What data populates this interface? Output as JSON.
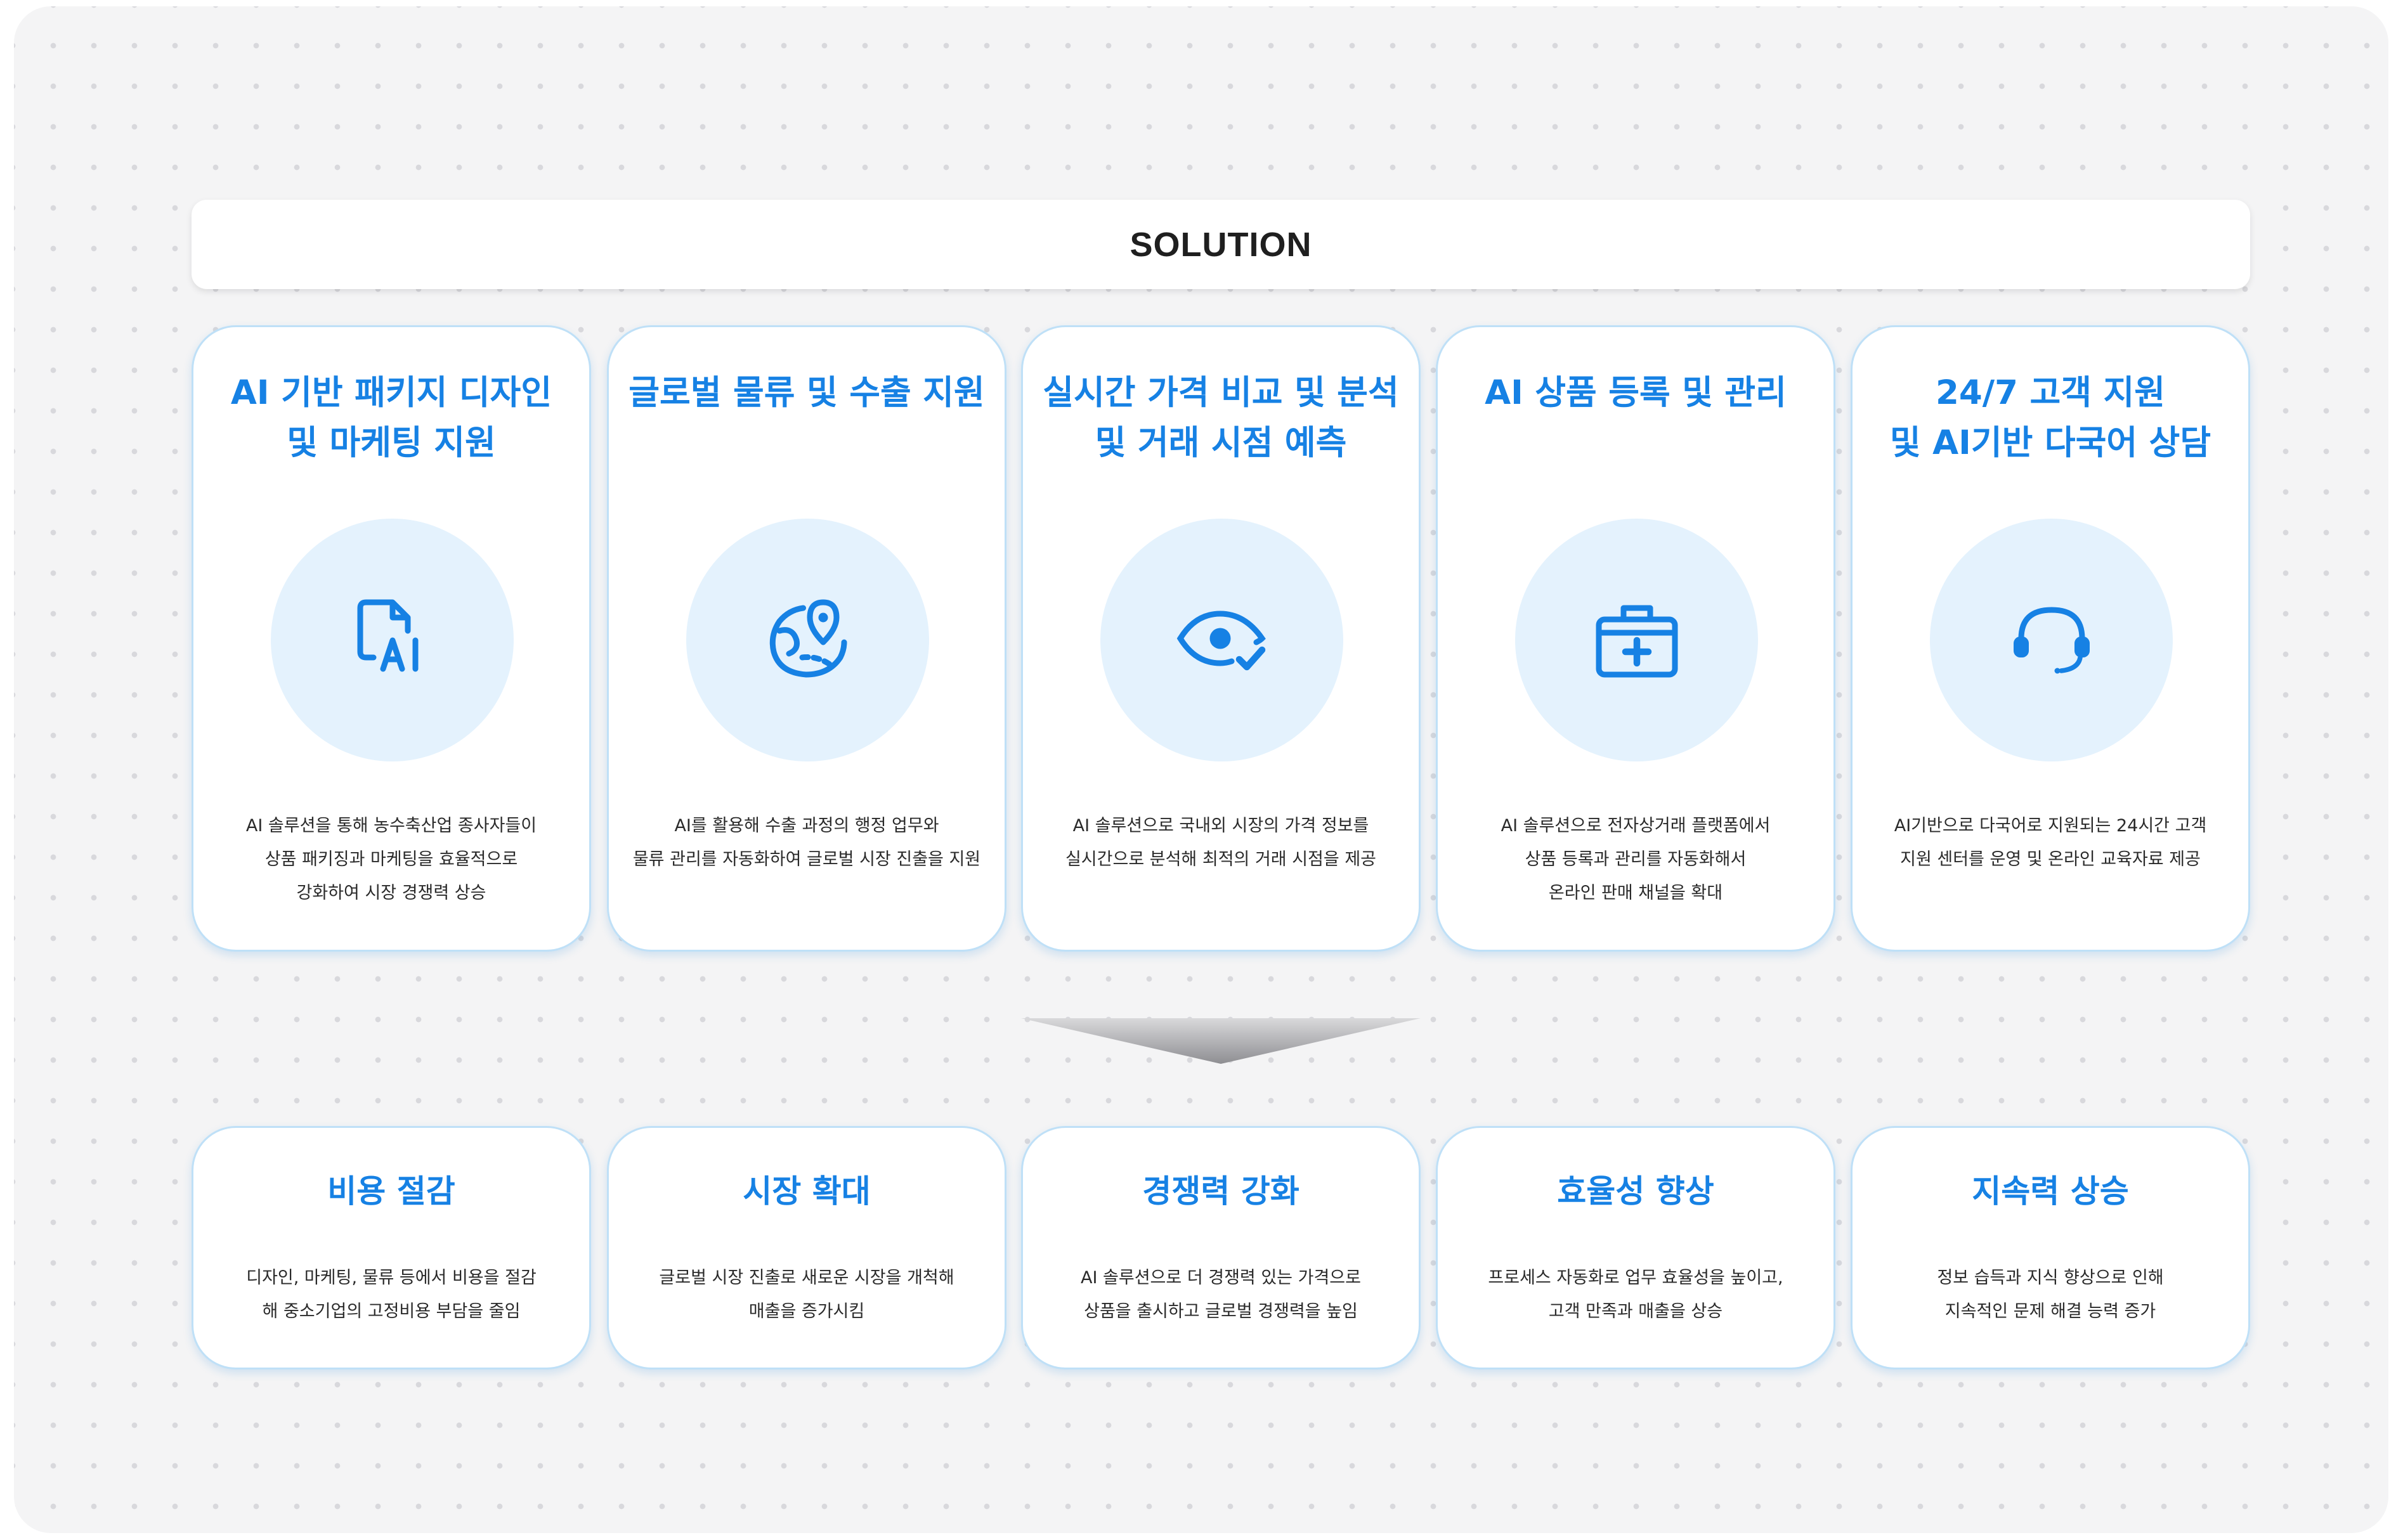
{
  "header": {
    "title": "SOLUTION"
  },
  "solutions": [
    {
      "title": "AI 기반 패키지 디자인\n및 마케팅 지원",
      "icon": "ai-document-icon",
      "description": "AI 솔루션을 통해 농수축산업 종사자들이\n상품 패키징과 마케팅을 효율적으로\n강화하여 시장 경쟁력 상승"
    },
    {
      "title": "글로벌 물류 및 수출 지원",
      "icon": "globe-location-icon",
      "description": "AI를 활용해 수출 과정의 행정 업무와\n물류 관리를 자동화하여 글로벌 시장 진출을 지원"
    },
    {
      "title": "실시간 가격 비교 및 분석\n및 거래 시점 예측",
      "icon": "eye-check-icon",
      "description": "AI 솔루션으로 국내외 시장의 가격 정보를\n실시간으로 분석해 최적의 거래 시점을 제공"
    },
    {
      "title": "AI 상품 등록 및 관리",
      "icon": "medical-kit-icon",
      "description": "AI 솔루션으로 전자상거래 플랫폼에서\n상품 등록과 관리를 자동화해서\n온라인 판매 채널을 확대"
    },
    {
      "title": "24/7 고객 지원\n및 AI기반 다국어 상담",
      "icon": "headset-icon",
      "description": "AI기반으로 다국어로 지원되는 24시간 고객\n지원 센터를 운영 및 온라인 교육자료 제공"
    }
  ],
  "benefits": [
    {
      "title": "비용 절감",
      "description": "디자인, 마케팅, 물류 등에서 비용을 절감\n해 중소기업의 고정비용 부담을 줄임"
    },
    {
      "title": "시장 확대",
      "description": "글로벌 시장 진출로 새로운 시장을 개척해\n매출을 증가시킴"
    },
    {
      "title": "경쟁력 강화",
      "description": "AI 솔루션으로 더 경쟁력 있는 가격으로\n상품을 출시하고 글로벌 경쟁력을 높임"
    },
    {
      "title": "효율성 향상",
      "description": "프로세스 자동화로 업무 효율성을 높이고,\n고객 만족과 매출을 상승"
    },
    {
      "title": "지속력 상승",
      "description": "정보 습득과 지식 향상으로 인해\n지속적인 문제 해결 능력 증가"
    }
  ],
  "colors": {
    "accent": "#1681e4",
    "icon_bg": "#e4f2fd",
    "card_border": "#bfe0f7",
    "background": "#f4f4f5"
  }
}
